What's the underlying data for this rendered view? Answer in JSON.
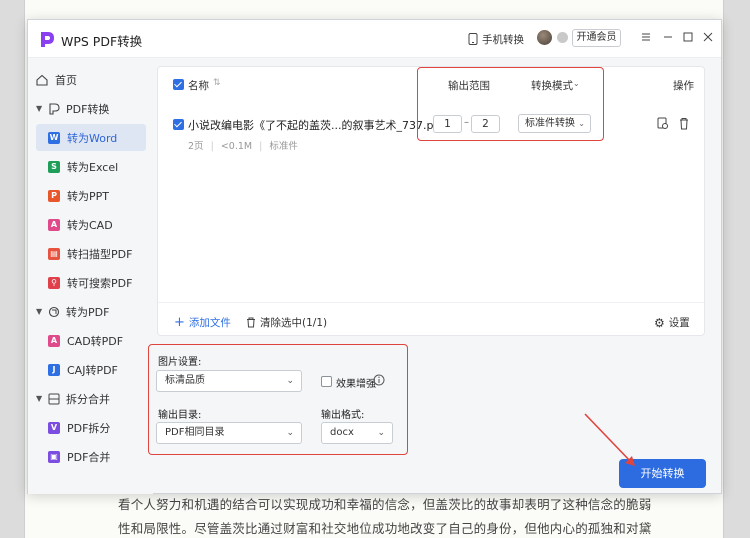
{
  "app": {
    "title": "WPS PDF转换"
  },
  "titlebar": {
    "mobile_label": "手机转换",
    "vip_label": "开通会员"
  },
  "sidebar": {
    "items": [
      {
        "label": "首页"
      },
      {
        "label": "PDF转换"
      },
      {
        "label": "转为Word"
      },
      {
        "label": "转为Excel"
      },
      {
        "label": "转为PPT"
      },
      {
        "label": "转为CAD"
      },
      {
        "label": "转扫描型PDF"
      },
      {
        "label": "转可搜索PDF"
      },
      {
        "label": "转为PDF"
      },
      {
        "label": "CAD转PDF"
      },
      {
        "label": "CAJ转PDF"
      },
      {
        "label": "拆分合并"
      },
      {
        "label": "PDF拆分"
      },
      {
        "label": "PDF合并"
      }
    ],
    "active": "转为Word"
  },
  "table": {
    "headers": {
      "name": "名称",
      "range": "输出范围",
      "mode": "转换模式",
      "action": "操作"
    },
    "rows": [
      {
        "filename": "小说改编电影《了不起的盖茨...的叙事艺术_737.pdf",
        "pages": "2页",
        "size": "<0.1M",
        "doc_type": "标准件",
        "range_from": "1",
        "range_to": "2",
        "range_sep": "–",
        "mode": "标准件转换"
      }
    ],
    "footer": {
      "add_label": "添加文件",
      "clear_label": "清除选中(1/1)",
      "settings_label": "设置"
    }
  },
  "settings": {
    "image_label": "图片设置:",
    "image_value": "标清品质",
    "enhance_label": "效果增强",
    "dir_label": "输出目录:",
    "dir_value": "PDF相同目录",
    "format_label": "输出格式:",
    "format_value": "docx"
  },
  "start_label": "开始转换",
  "background_text": {
    "line1": "看个人努力和机遇的结合可以实现成功和幸福的信念，但盖茨比的故事却表明了这种信念的脆弱",
    "line2": "性和局限性。尽管盖茨比通过财富和社交地位成功地改变了自己的身份，但他内心的孤独和对黛"
  },
  "colors": {
    "accent": "#2c6be0",
    "highlight": "#e0443e",
    "active_bg": "#dfe6f3"
  }
}
